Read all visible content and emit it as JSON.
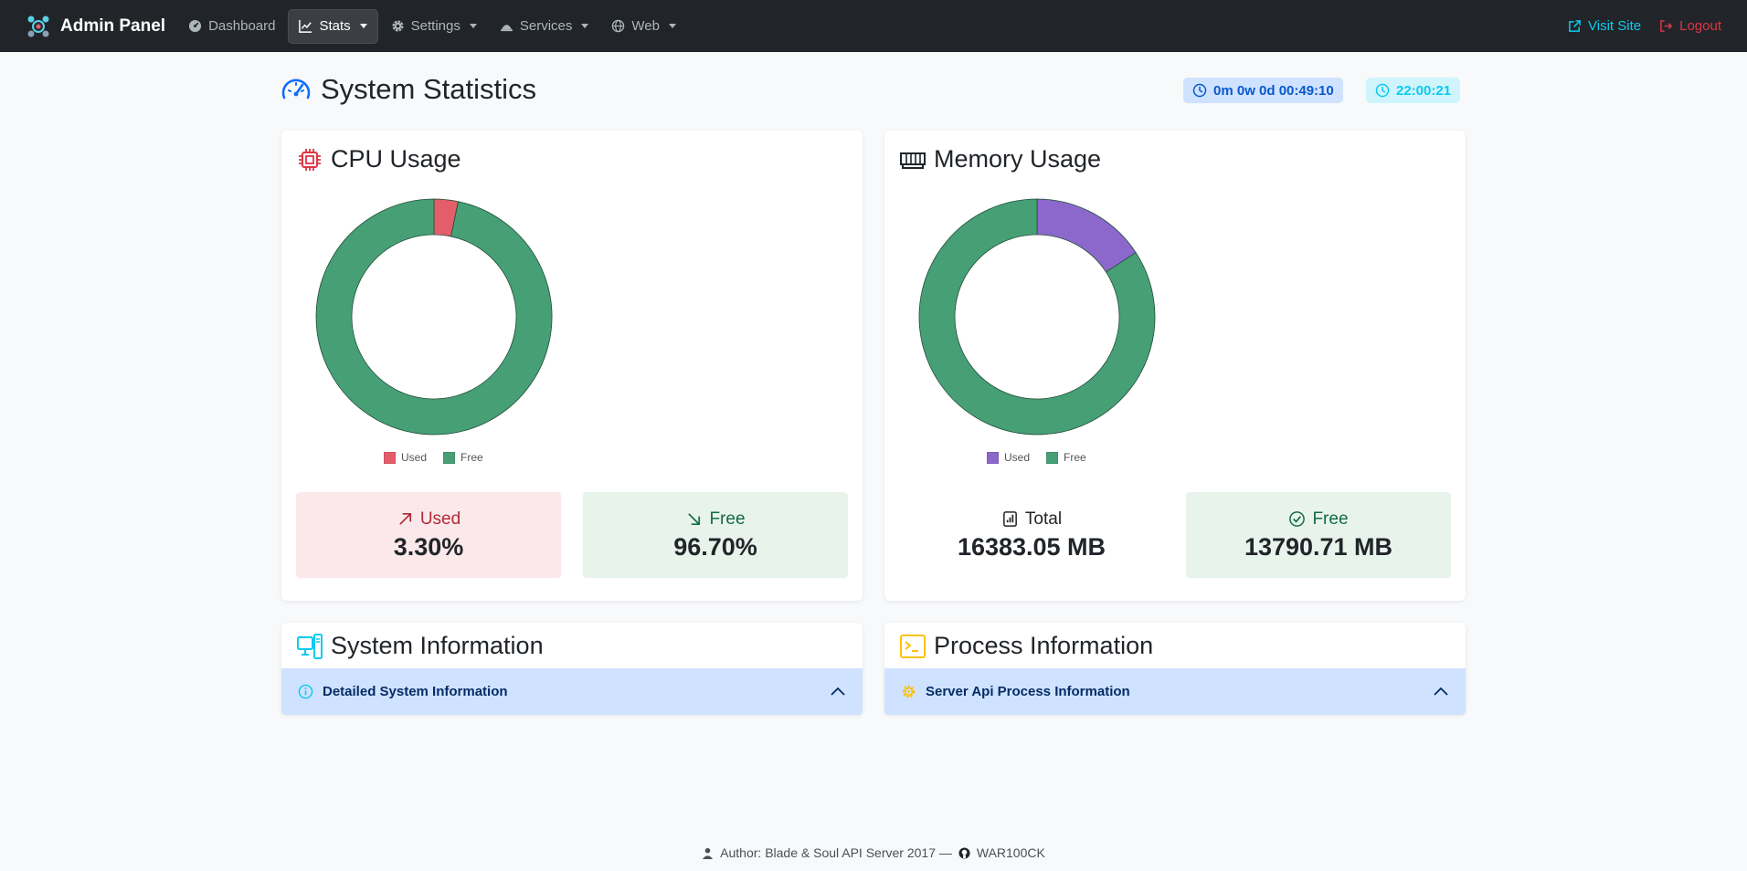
{
  "navbar": {
    "brand": "Admin Panel",
    "items": [
      {
        "label": "Dashboard",
        "icon": "speedometer-icon",
        "dropdown": false
      },
      {
        "label": "Stats",
        "icon": "chart-line-icon",
        "dropdown": true,
        "active": true
      },
      {
        "label": "Settings",
        "icon": "gear-icon",
        "dropdown": true
      },
      {
        "label": "Services",
        "icon": "bell-icon",
        "dropdown": true
      },
      {
        "label": "Web",
        "icon": "globe-icon",
        "dropdown": true
      }
    ],
    "visit_site": "Visit Site",
    "logout": "Logout"
  },
  "header": {
    "title": "System Statistics",
    "uptime": "0m 0w 0d 00:49:10",
    "clock": "22:00:21"
  },
  "cpu": {
    "title": "CPU Usage",
    "used_label": "Used",
    "used_value": "3.30%",
    "free_label": "Free",
    "free_value": "96.70%"
  },
  "memory": {
    "title": "Memory Usage",
    "total_label": "Total",
    "total_value": "16383.05 MB",
    "free_label": "Free",
    "free_value": "13790.71 MB"
  },
  "system_info": {
    "title": "System Information",
    "accordion_label": "Detailed System Information"
  },
  "process_info": {
    "title": "Process Information",
    "accordion_label": "Server Api Process Information"
  },
  "footer": {
    "text": "Author: Blade & Soul API Server 2017 —",
    "github": "WAR100CK"
  },
  "colors": {
    "used_red": "#e35d6a",
    "free_green": "#479f76",
    "used_purple": "#8c68cd"
  },
  "chart_data": [
    {
      "type": "pie",
      "categories": [
        "Used",
        "Free"
      ],
      "values": [
        3.3,
        96.7
      ],
      "colors": [
        "#e35d6a",
        "#479f76"
      ],
      "legend": "bottom"
    },
    {
      "type": "pie",
      "categories": [
        "Used",
        "Free"
      ],
      "values": [
        2592.34,
        13790.71
      ],
      "colors": [
        "#8c68cd",
        "#479f76"
      ],
      "legend": "bottom"
    }
  ]
}
